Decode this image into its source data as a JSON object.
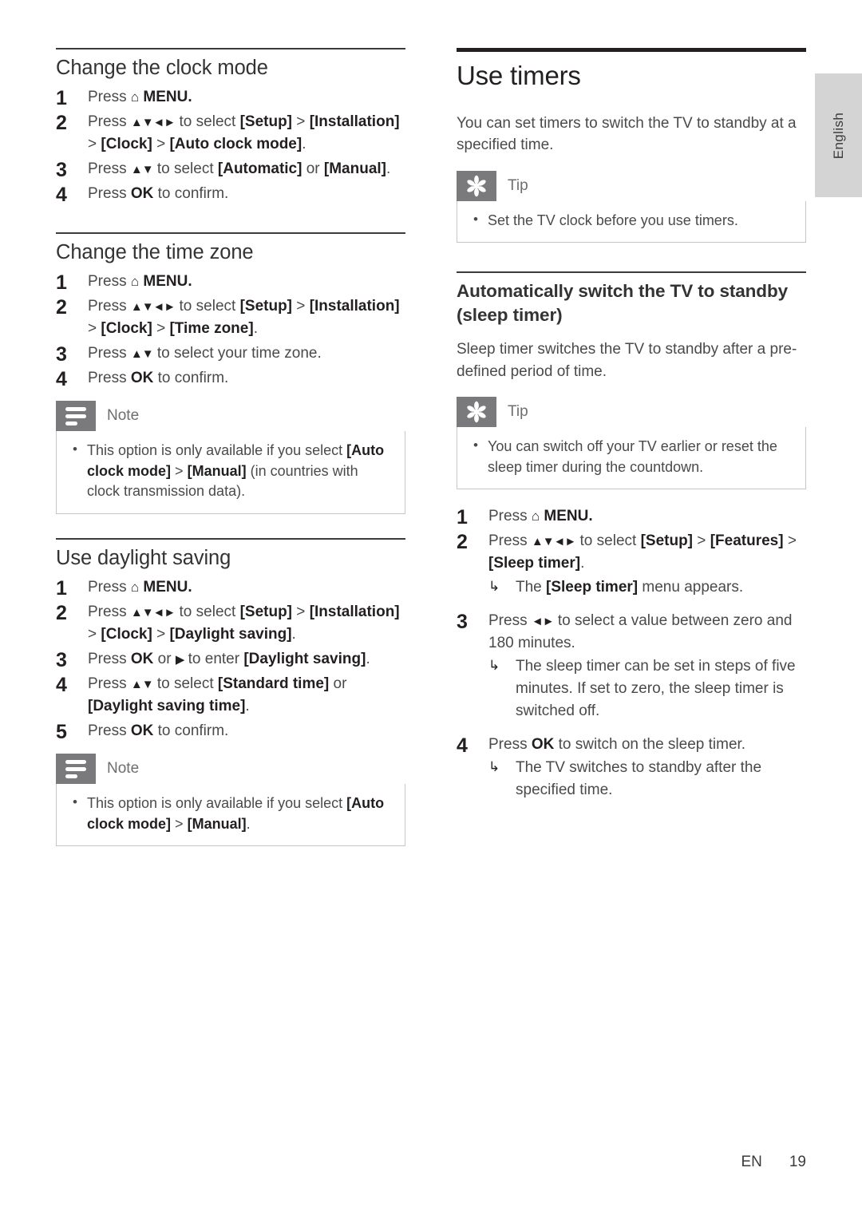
{
  "page": {
    "language_tab": "English",
    "footer": {
      "lang_code": "EN",
      "page_number": "19"
    }
  },
  "left_column": {
    "sections": [
      {
        "heading": "Change the clock mode",
        "steps": [
          {
            "pre": "Press ",
            "glyph": "home",
            "post": " MENU."
          },
          {
            "pre": "Press ",
            "glyph": "updownleftright",
            "post": " to select [Setup] > [Installation] > [Clock] > [Auto clock mode]."
          },
          {
            "pre": "Press ",
            "glyph": "updown",
            "post": " to select [Automatic] or [Manual]."
          },
          {
            "pre": "Press ",
            "glyph": "ok",
            "post": " to confirm."
          }
        ]
      },
      {
        "heading": "Change the time zone",
        "steps": [
          {
            "pre": "Press ",
            "glyph": "home",
            "post": " MENU."
          },
          {
            "pre": "Press ",
            "glyph": "updownleftright",
            "post": " to select [Setup] > [Installation] > [Clock] > [Time zone]."
          },
          {
            "pre": "Press ",
            "glyph": "updown",
            "post": " to select your time zone."
          },
          {
            "pre": "Press ",
            "glyph": "ok",
            "post": " to confirm."
          }
        ],
        "note": {
          "title": "Note",
          "items": [
            "This option is only available if you select [Auto clock mode] > [Manual] (in countries with clock transmission data)."
          ]
        }
      },
      {
        "heading": "Use daylight saving",
        "steps": [
          {
            "pre": "Press ",
            "glyph": "home",
            "post": " MENU."
          },
          {
            "pre": "Press ",
            "glyph": "updownleftright",
            "post": " to select [Setup] > [Installation] > [Clock] > [Daylight saving]."
          },
          {
            "pre": "Press ",
            "glyph": "ok_or_right",
            "post": " to enter [Daylight saving]."
          },
          {
            "pre": "Press ",
            "glyph": "updown",
            "post": " to select [Standard time] or [Daylight saving time]."
          },
          {
            "pre": "Press ",
            "glyph": "ok",
            "post": " to confirm."
          }
        ],
        "note": {
          "title": "Note",
          "items": [
            "This option is only available if you select [Auto clock mode] > [Manual]."
          ]
        }
      }
    ]
  },
  "right_column": {
    "chapter_heading": "Use timers",
    "intro": "You can set timers to switch the TV to standby at a specified time.",
    "tip_1": {
      "title": "Tip",
      "items": [
        "Set the TV clock before you use timers."
      ]
    },
    "subsection": {
      "heading": "Automatically switch the TV to standby (sleep timer)",
      "intro": "Sleep timer switches the TV to standby after a pre-defined period of time.",
      "tip": {
        "title": "Tip",
        "items": [
          "You can switch off your TV earlier or reset the sleep timer during the countdown."
        ]
      },
      "steps": [
        {
          "pre": "Press ",
          "glyph": "home",
          "post": " MENU."
        },
        {
          "pre": "Press ",
          "glyph": "updownleftright",
          "post": " to select [Setup] > [Features] > [Sleep timer].",
          "sub": "The [Sleep timer] menu appears."
        },
        {
          "pre": "Press ",
          "glyph": "leftright",
          "post": " to select a value between zero and 180 minutes.",
          "sub": "The sleep timer can be set in steps of five minutes. If set to zero, the sleep timer is switched off."
        },
        {
          "pre": "Press ",
          "glyph": "ok",
          "post": " to switch on the sleep timer.",
          "sub": "The TV switches to standby after the specified time."
        }
      ]
    }
  },
  "glyphs": {
    "home": "⌂",
    "updown": "▲▼",
    "leftright": "◄►",
    "updownleftright": "▲▼◄►",
    "right": "▶",
    "substep_arrow": "↳",
    "bullet": "•"
  },
  "colors": {
    "callout_icon_bg": "#7a7a7d",
    "callout_border": "#c6c6c6",
    "lang_tab_bg": "#d4d4d4",
    "heading": "#333333",
    "body": "#4a4a4a"
  }
}
